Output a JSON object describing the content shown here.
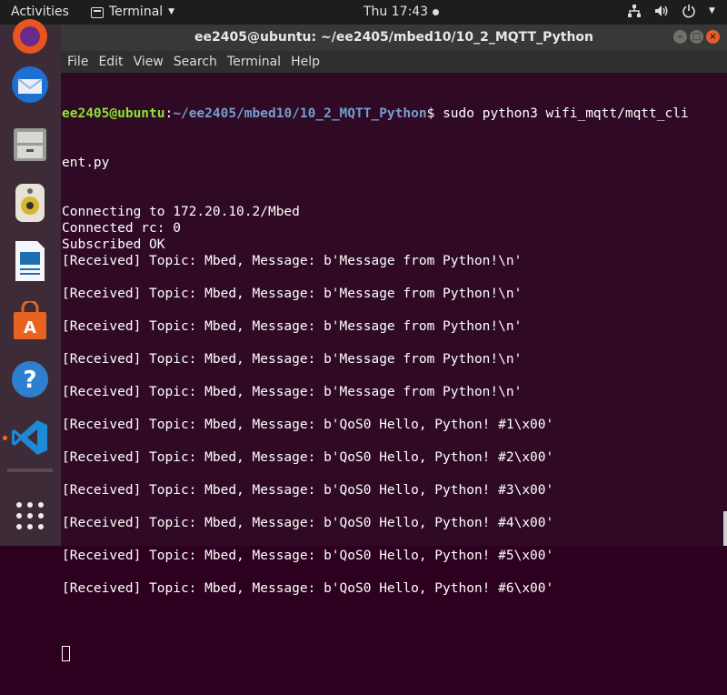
{
  "topbar": {
    "activities": "Activities",
    "app_menu_label": "Terminal",
    "clock": "Thu 17:43",
    "tray_icons": [
      "network-icon",
      "volume-icon",
      "power-icon"
    ]
  },
  "dock": {
    "items": [
      "firefox-icon",
      "thunderbird-icon",
      "files-icon",
      "rhythmbox-icon",
      "writer-icon",
      "software-icon",
      "help-icon",
      "vscode-icon",
      "show-apps-icon"
    ],
    "colors": {
      "accent": "#ff6a1e",
      "bg": "#3d2b37"
    }
  },
  "window": {
    "title": "ee2405@ubuntu: ~/ee2405/mbed10/10_2_MQTT_Python",
    "menu": [
      "File",
      "Edit",
      "View",
      "Search",
      "Terminal",
      "Help"
    ]
  },
  "terminal": {
    "prompt_user": "ee2405@ubuntu",
    "prompt_sep": ":",
    "prompt_path": "~/ee2405/mbed10/10_2_MQTT_Python",
    "prompt_symbol": "$ ",
    "command_part1": "sudo python3 wifi_mqtt/mqtt_cli",
    "command_part2": "ent.py",
    "lines": [
      "Connecting to 172.20.10.2/Mbed",
      "Connected rc: 0",
      "Subscribed OK",
      "[Received] Topic: Mbed, Message: b'Message from Python!\\n'",
      "",
      "[Received] Topic: Mbed, Message: b'Message from Python!\\n'",
      "",
      "[Received] Topic: Mbed, Message: b'Message from Python!\\n'",
      "",
      "[Received] Topic: Mbed, Message: b'Message from Python!\\n'",
      "",
      "[Received] Topic: Mbed, Message: b'Message from Python!\\n'",
      "",
      "[Received] Topic: Mbed, Message: b'QoS0 Hello, Python! #1\\x00'",
      "",
      "[Received] Topic: Mbed, Message: b'QoS0 Hello, Python! #2\\x00'",
      "",
      "[Received] Topic: Mbed, Message: b'QoS0 Hello, Python! #3\\x00'",
      "",
      "[Received] Topic: Mbed, Message: b'QoS0 Hello, Python! #4\\x00'",
      "",
      "[Received] Topic: Mbed, Message: b'QoS0 Hello, Python! #5\\x00'",
      "",
      "[Received] Topic: Mbed, Message: b'QoS0 Hello, Python! #6\\x00'",
      ""
    ]
  }
}
